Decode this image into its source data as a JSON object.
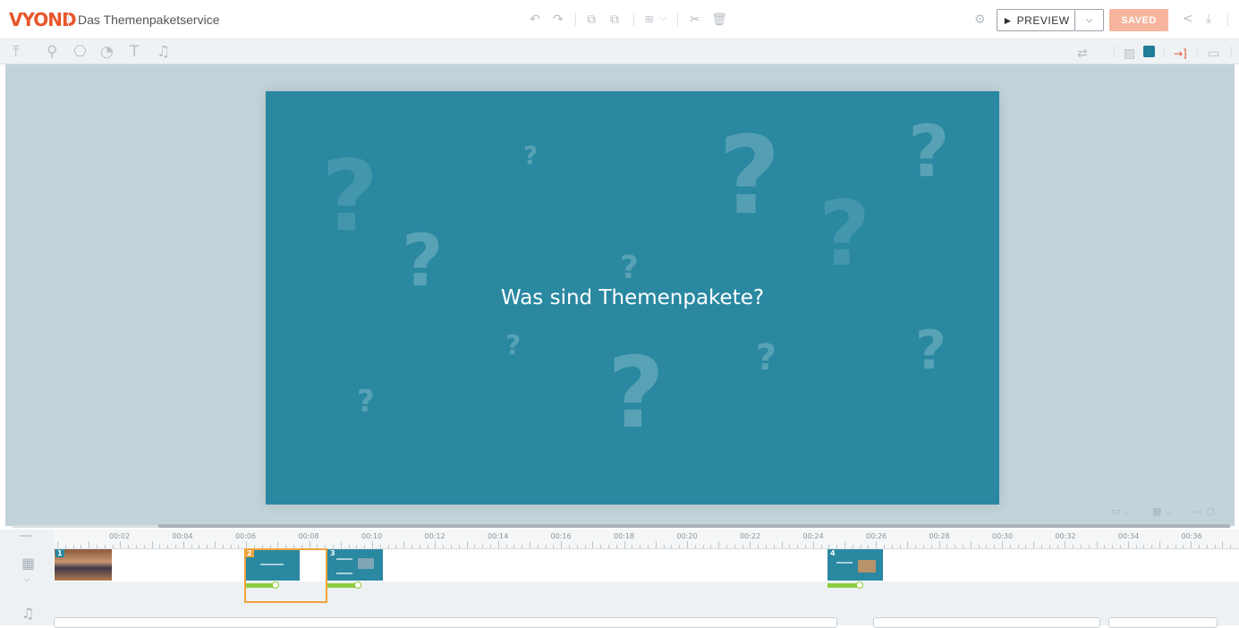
{
  "app": {
    "logo": "VYOND",
    "project_title": "Das Themenpaketservice"
  },
  "header": {
    "undo_icon": "↶",
    "redo_icon": "↷",
    "copy_icon": "⧉",
    "paste_icon": "⧉",
    "layers_icon": "≋",
    "layers_drop": "⌵",
    "magic_icon": "✂",
    "delete_icon": "🗑",
    "settings_icon": "⚙",
    "preview_label": "► PREVIEW",
    "preview_drop": "⌵",
    "saved_label": "SAVED",
    "share_icon": "<",
    "download_icon": "⤓"
  },
  "tools": {
    "upload": "⤒",
    "character": "⚲",
    "props": "⎔",
    "charts": "◔",
    "text": "T",
    "audio": "♫",
    "swap": "⇄",
    "background": "▨",
    "color": "#1f7d99",
    "enter": "→]",
    "camera": "▭"
  },
  "slide": {
    "title": "Was sind Themenpakete?",
    "background_color": "#2a88a1"
  },
  "view_controls": {
    "screen": "▭ ⌵",
    "grid": "▦ ⌵",
    "zoom": "— ◻"
  },
  "timeline": {
    "ticks": [
      "00:02",
      "00:04",
      "00:06",
      "00:08",
      "00:10",
      "00:12",
      "00:14",
      "00:16",
      "00:18",
      "00:20",
      "00:22",
      "00:24",
      "00:26",
      "00:28",
      "00:30",
      "00:32",
      "00:34",
      "00:36"
    ],
    "scenes": [
      {
        "num": "1"
      },
      {
        "num": "2"
      },
      {
        "num": "3"
      },
      {
        "num": "4"
      }
    ],
    "scene_icon": "▦",
    "audio_icon": "♫",
    "collapse_icon": "⌵"
  }
}
